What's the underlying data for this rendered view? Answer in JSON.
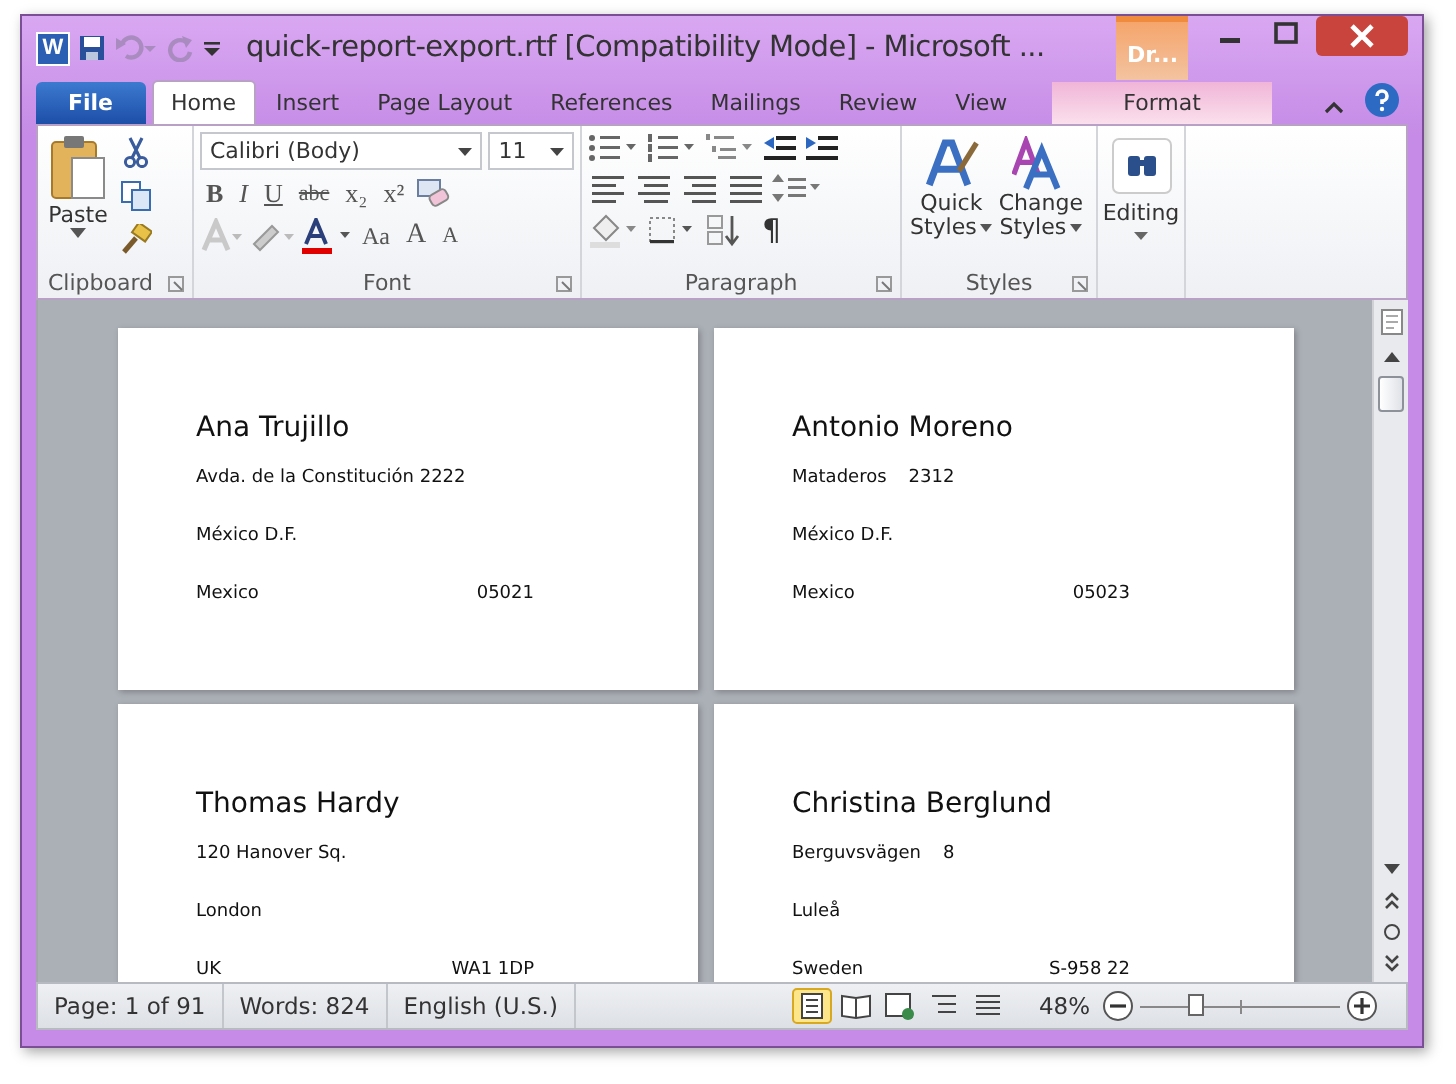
{
  "window": {
    "app_letter": "W",
    "title": "quick-report-export.rtf [Compatibility Mode]  -  Microsoft ...",
    "context_group": "Dr..."
  },
  "tabs": [
    {
      "label": "File",
      "kind": "file",
      "selected": false
    },
    {
      "label": "Home",
      "kind": "tab",
      "selected": true
    },
    {
      "label": "Insert",
      "kind": "tab",
      "selected": false
    },
    {
      "label": "Page Layout",
      "kind": "tab",
      "selected": false
    },
    {
      "label": "References",
      "kind": "tab",
      "selected": false
    },
    {
      "label": "Mailings",
      "kind": "tab",
      "selected": false
    },
    {
      "label": "Review",
      "kind": "tab",
      "selected": false
    },
    {
      "label": "View",
      "kind": "tab",
      "selected": false
    },
    {
      "label": "Format",
      "kind": "context",
      "selected": false
    }
  ],
  "ribbon": {
    "clipboard": {
      "paste": "Paste",
      "label": "Clipboard"
    },
    "font": {
      "name": "Calibri (Body)",
      "size": "11",
      "format_buttons": [
        "B",
        "I",
        "U",
        "abc",
        "x₂",
        "x²"
      ],
      "case_button": "Aa",
      "grow_button": "A",
      "shrink_button": "A",
      "label": "Font"
    },
    "paragraph": {
      "label": "Paragraph",
      "pilcrow": "¶"
    },
    "styles": {
      "quick_line1": "Quick",
      "quick_line2": "Styles",
      "change_line1": "Change",
      "change_line2": "Styles",
      "label": "Styles"
    },
    "editing": {
      "label": "Editing"
    }
  },
  "pages": [
    {
      "name": "Ana Trujillo",
      "lines": [
        {
          "text": "Avda. de la Constitución 2222",
          "kind": "plain"
        },
        {
          "text": "México D.F.",
          "kind": "plain"
        },
        {
          "text": "Mexico",
          "value": "05021",
          "kind": "spread"
        }
      ]
    },
    {
      "name": "Antonio Moreno",
      "lines": [
        {
          "text": "Mataderos",
          "value": "2312",
          "kind": "close"
        },
        {
          "text": "México D.F.",
          "kind": "plain"
        },
        {
          "text": "Mexico",
          "value": "05023",
          "kind": "spread"
        }
      ]
    },
    {
      "name": "Thomas Hardy",
      "lines": [
        {
          "text": "120 Hanover Sq.",
          "kind": "plain"
        },
        {
          "text": "London",
          "kind": "plain"
        },
        {
          "text": "UK",
          "value": "WA1 1DP",
          "kind": "spread"
        }
      ]
    },
    {
      "name": "Christina Berglund",
      "lines": [
        {
          "text": "Berguvsvägen",
          "value": "8",
          "kind": "close"
        },
        {
          "text": "Luleå",
          "kind": "plain"
        },
        {
          "text": "Sweden",
          "value": "S-958 22",
          "kind": "spread"
        }
      ]
    }
  ],
  "status_bar": {
    "page": "Page: 1 of 91",
    "words": "Words: 824",
    "language": "English (U.S.)",
    "views": [
      {
        "kind": "print",
        "selected": true
      },
      {
        "kind": "reading",
        "selected": false
      },
      {
        "kind": "web",
        "selected": false
      },
      {
        "kind": "outline",
        "selected": false
      },
      {
        "kind": "draft",
        "selected": false
      }
    ],
    "zoom": "48%",
    "zoom_level": {
      "level": 0.28
    }
  }
}
